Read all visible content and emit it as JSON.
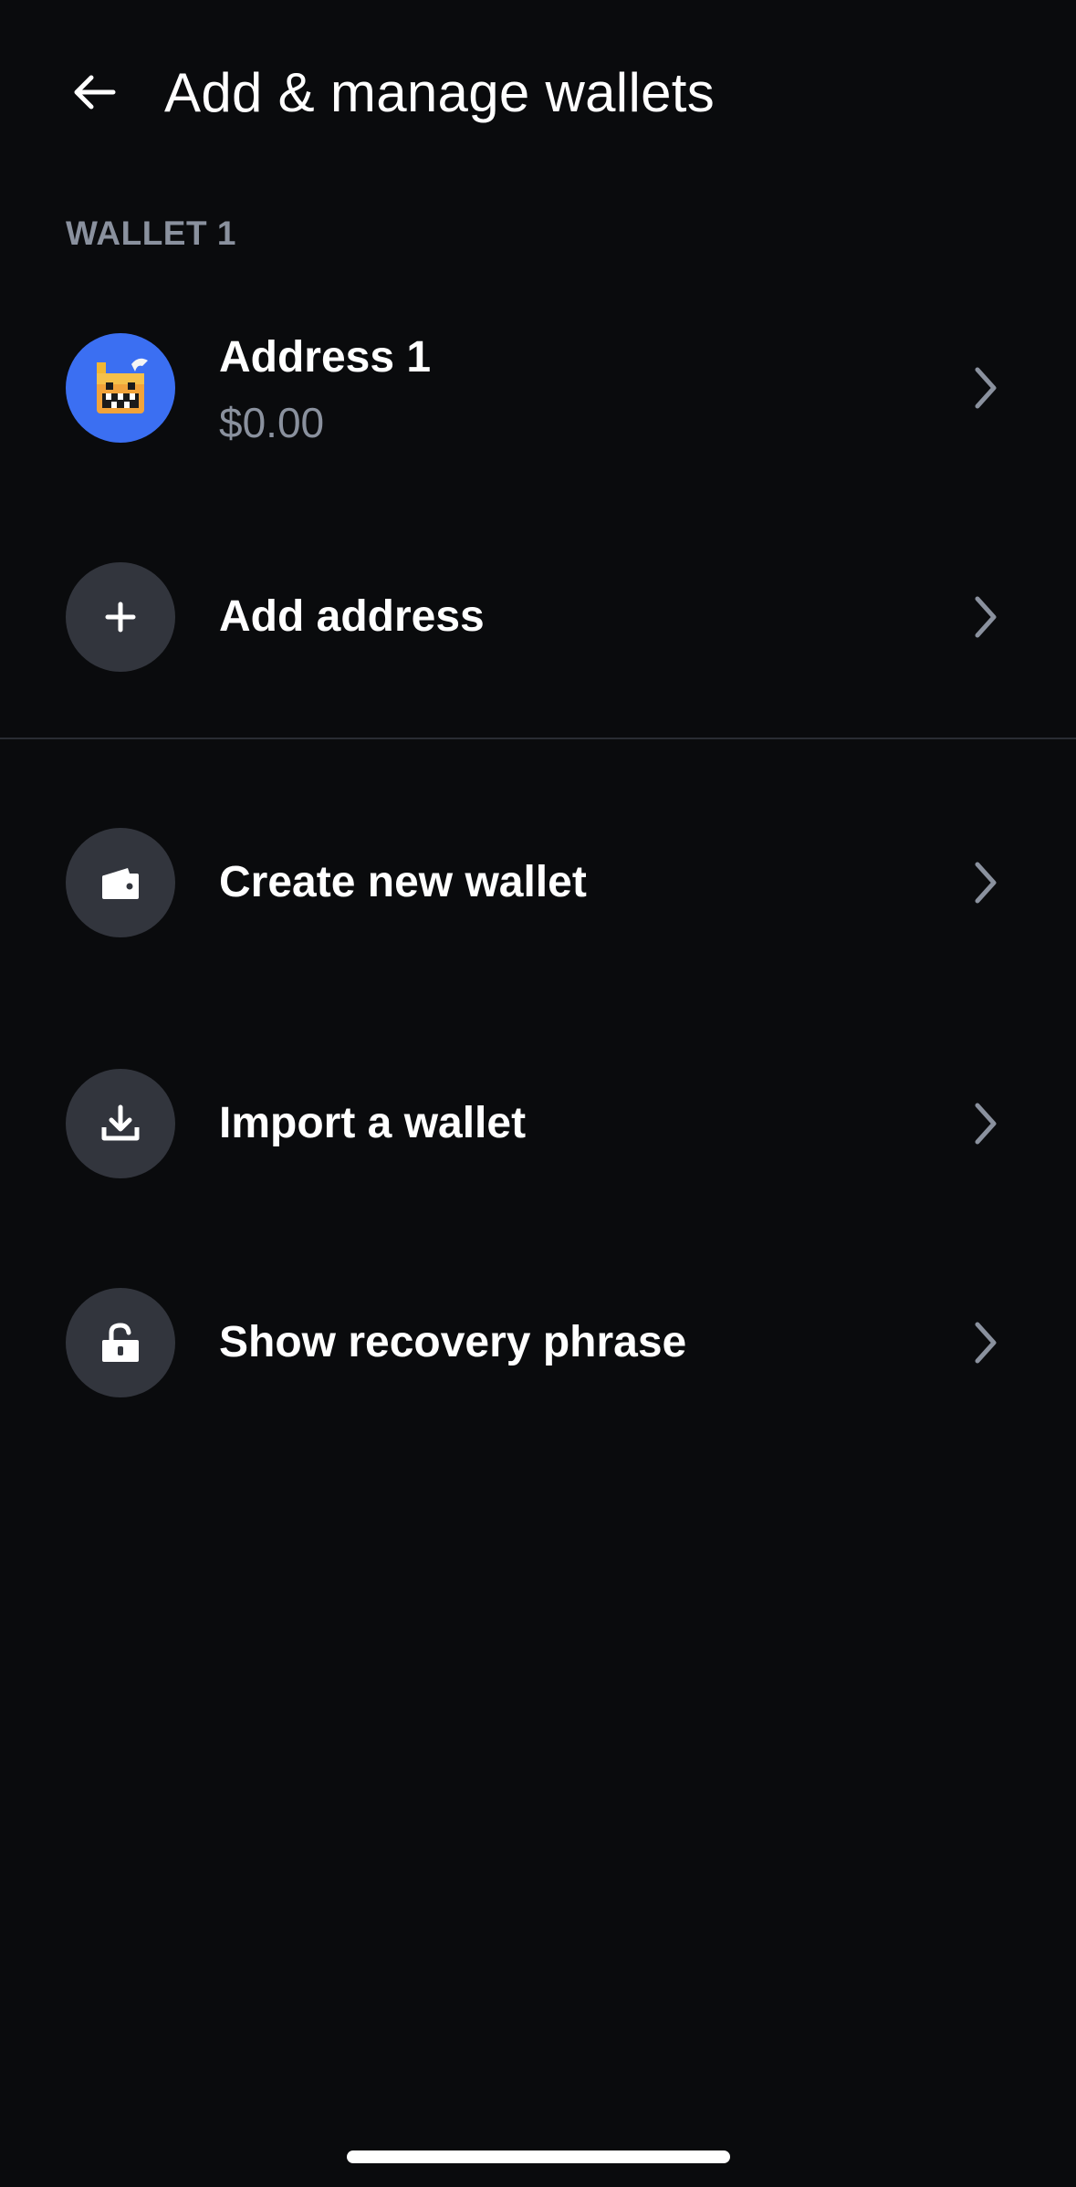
{
  "header": {
    "title": "Add & manage wallets",
    "back_icon": "arrow-left-icon"
  },
  "wallet_section": {
    "label": "WALLET 1",
    "address": {
      "name": "Address 1",
      "balance": "$0.00",
      "avatar_color": "#3b6ff2"
    },
    "add_address": {
      "label": "Add address",
      "icon": "plus-icon"
    }
  },
  "actions": [
    {
      "label": "Create new wallet",
      "icon": "wallet-icon"
    },
    {
      "label": "Import a wallet",
      "icon": "download-icon"
    },
    {
      "label": "Show recovery phrase",
      "icon": "unlock-icon"
    }
  ],
  "colors": {
    "background": "#0a0b0d",
    "icon_circle": "#32353d",
    "secondary_text": "#8a919e",
    "accent": "#3b6ff2"
  }
}
